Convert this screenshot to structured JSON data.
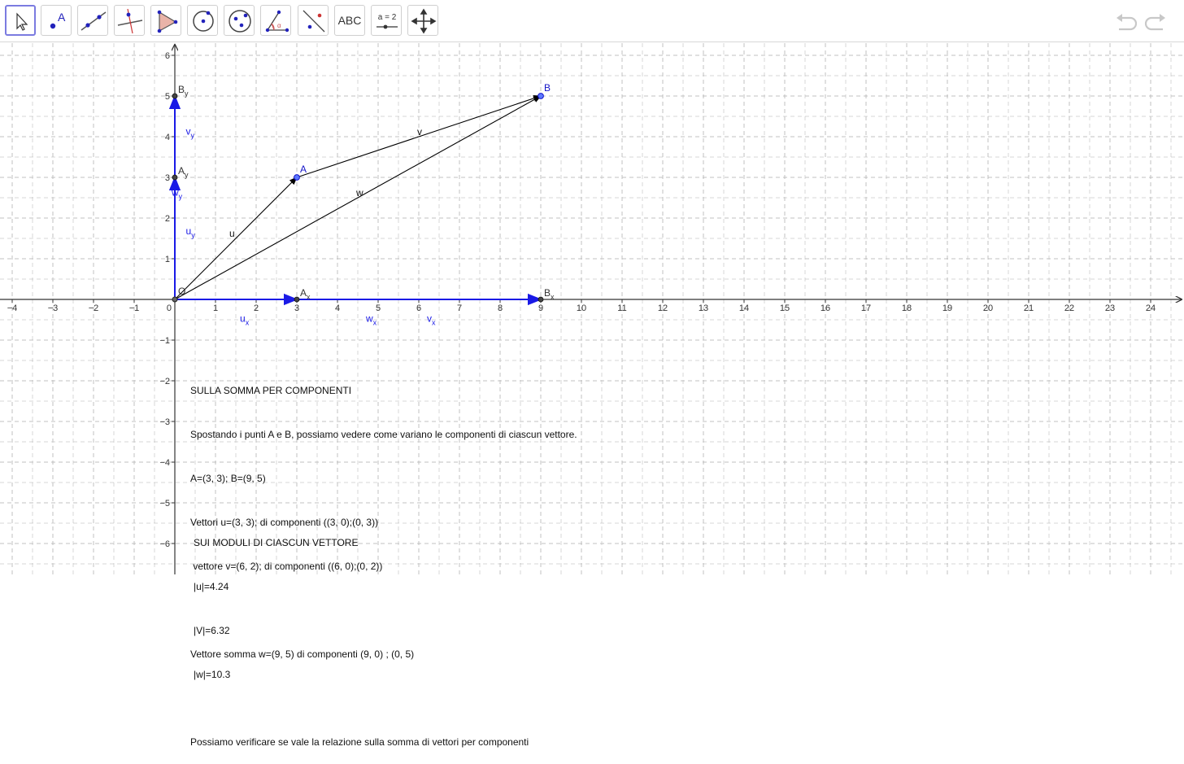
{
  "toolbar": {
    "tools": [
      {
        "name": "move-tool",
        "label": ""
      },
      {
        "name": "point-tool",
        "label": "A"
      },
      {
        "name": "line-tool",
        "label": ""
      },
      {
        "name": "perpendicular-line-tool",
        "label": ""
      },
      {
        "name": "polygon-tool",
        "label": ""
      },
      {
        "name": "circle-tool",
        "label": ""
      },
      {
        "name": "ellipse-tool",
        "label": ""
      },
      {
        "name": "angle-tool",
        "label": ""
      },
      {
        "name": "reflect-tool",
        "label": ""
      },
      {
        "name": "text-tool",
        "label": "ABC"
      },
      {
        "name": "slider-tool",
        "label": "a = 2"
      },
      {
        "name": "move-graphics-tool",
        "label": ""
      }
    ],
    "undo_icon": "undo-icon",
    "redo_icon": "redo-icon"
  },
  "graph": {
    "x_range": [
      -4,
      24
    ],
    "y_range": [
      -6,
      6
    ],
    "x_ticks": [
      "-4",
      "-3",
      "-2",
      "-1",
      "0",
      "1",
      "2",
      "3",
      "4",
      "5",
      "6",
      "7",
      "8",
      "9",
      "10",
      "11",
      "12",
      "13",
      "14",
      "15",
      "16",
      "17",
      "18",
      "19",
      "20",
      "21",
      "22",
      "23",
      "24"
    ],
    "y_ticks": [
      "6",
      "5",
      "4",
      "3",
      "2",
      "1",
      "-1",
      "-2",
      "-3",
      "-4",
      "-5",
      "-6"
    ],
    "grid": "dashed",
    "colors": {
      "points": "#1515c8",
      "components": "#1a1ae6",
      "vectors": "#000000",
      "grid": "#b8b8b8"
    },
    "points": [
      {
        "label": "A",
        "x": 3,
        "y": 3
      },
      {
        "label": "B",
        "x": 9,
        "y": 5
      },
      {
        "label": "O",
        "x": 0,
        "y": 0
      }
    ],
    "projections": [
      {
        "label": "A",
        "sub": "x",
        "x": 3,
        "y": 0
      },
      {
        "label": "B",
        "sub": "x",
        "x": 9,
        "y": 0
      },
      {
        "label": "A",
        "sub": "y",
        "x": 0,
        "y": 3
      },
      {
        "label": "B",
        "sub": "y",
        "x": 0,
        "y": 5
      }
    ],
    "vectors": [
      {
        "label": "u",
        "from": [
          0,
          0
        ],
        "to": [
          3,
          3
        ]
      },
      {
        "label": "v",
        "from": [
          3,
          3
        ],
        "to": [
          9,
          5
        ]
      },
      {
        "label": "w",
        "from": [
          0,
          0
        ],
        "to": [
          9,
          5
        ]
      }
    ],
    "component_labels": [
      {
        "label": "u",
        "sub": "x"
      },
      {
        "label": "w",
        "sub": "x"
      },
      {
        "label": "v",
        "sub": "x"
      },
      {
        "label": "u",
        "sub": "y"
      },
      {
        "label": "w",
        "sub": "y"
      },
      {
        "label": "v",
        "sub": "y"
      }
    ]
  },
  "text": {
    "block1": [
      "SULLA SOMMA PER COMPONENTI",
      "Spostando i punti A e B, possiamo vedere come variano le componenti di ciascun vettore.",
      "A=(3, 3); B=(9, 5)",
      "Vettori u=(3, 3); di componenti ((3, 0);(0, 3))",
      " vettore v=(6, 2); di componenti ((6, 0);(0, 2))",
      "",
      "Vettore somma w=(9, 5) di componenti (9, 0) ; (0, 5)",
      "",
      "Possiamo verificare se vale la relazione sulla somma di vettori per componenti"
    ],
    "block2": [
      "SUI MODULI DI CIASCUN VETTORE",
      "|u|=4.24",
      "|V|=6.32",
      "|w|=10.3"
    ]
  }
}
